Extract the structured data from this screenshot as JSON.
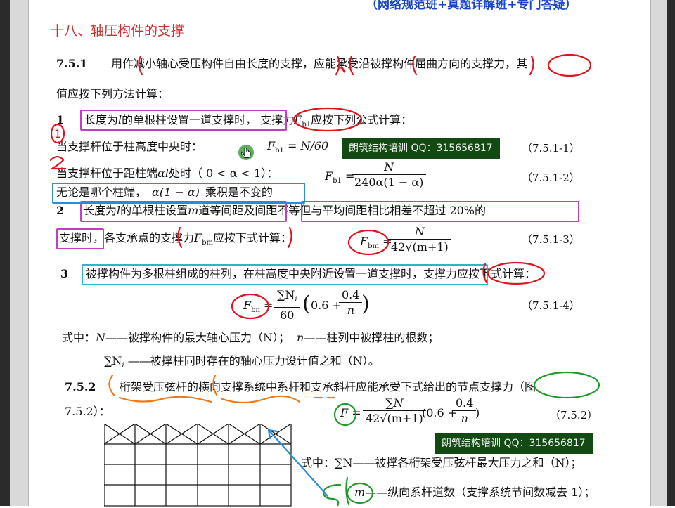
{
  "header": {
    "banner": "（网络规范班+真题详解班+专门答疑）"
  },
  "section": {
    "title": "十八、轴压构件的支撑"
  },
  "clause_751": {
    "number": "7.5.1",
    "line1_a": "用作",
    "line1_b": "减小轴心受压构件自由长度的支撑",
    "line1_c": "，",
    "line1_d": "应能承受",
    "line1_e": "沿被撑构件屈曲方向",
    "line1_f": "的",
    "line1_g": "支撑力",
    "line1_h": "，其",
    "line2": "值应按下列方法计算："
  },
  "item1": {
    "num": "1",
    "a": "长度为",
    "l": "l",
    "b": "的单根柱设置一道支撑时",
    "c": "，",
    "d": "支撑力",
    "F": "F",
    "sub": "b1",
    "e": "应按下列公式计算：",
    "case1": "当支撑杆位于柱高度中央时：",
    "eq1_lhs": "F",
    "eq1_sub": "b1",
    "eq1_rhs": "= N/60",
    "eq1_no": "（7.5.1-1）",
    "case2": "当支撑杆位于距柱端",
    "case2_al": "αl",
    "case2_b": "处时（ 0 < α < 1）：",
    "eq2_lhs": "F",
    "eq2_sub": "b1",
    "eq2_eq": "=",
    "eq2_num": "N",
    "eq2_den": "240α(1 − α)",
    "eq2_no": "（7.5.1-2）",
    "note": "无论是哪个柱端，",
    "note_expr": "α(1 − α)",
    "note_b": "乘积是不变的"
  },
  "item2": {
    "num": "2",
    "a": "长度为",
    "l": "l",
    "b": "的单根柱设置",
    "m": "m",
    "c": "道等间距",
    "d": "及",
    "e": "间距不等但与平均间距相比相差不超过 20%的",
    "f": "支撑时",
    "g": "，各支承点的支撑力",
    "F": "F",
    "sub": "bm",
    "h": "应按下式计算：",
    "eq_lhs": "F",
    "eq_sub": "bm",
    "eq_eq": "=",
    "eq_num": "N",
    "eq_den": "42√(m+1)",
    "eq_no": "（7.5.1-3）"
  },
  "item3": {
    "num": "3",
    "a": "被撑构件为多根柱组成的柱列，在柱高度中央附近设置一道支撑时",
    "b": "，",
    "c": "支撑力",
    "d": "应按下式计算：",
    "eq_lhs": "F",
    "eq_sub": "bn",
    "eq_eq": "=",
    "eq_num": "∑N",
    "eq_num_sub": "i",
    "eq_den": "60",
    "eq_open": "(",
    "eq_mid": "0.6 +",
    "eq_f2_num": "0.4",
    "eq_f2_den": "n",
    "eq_close": ")",
    "eq_no": "（7.5.1-4）",
    "where1_a": "式中：",
    "where1_N": "N",
    "where1_b": "——被撑构件的最大轴心压力（N）；",
    "where1_n": "n",
    "where1_c": "——柱列中被撑柱的根数；",
    "where2_sum": "∑N",
    "where2_sub": "i",
    "where2_b": "——被撑柱同时存在的轴心压力设计值之和（N）。"
  },
  "clause_752": {
    "number": "7.5.2",
    "a": "桁架受压弦杆的横向支撑系统中系杆和支承斜杆应能承受下式给出的节点支撑力（图",
    "b": "7.5.2）：",
    "eq_lhs": "F",
    "eq_eq": "=",
    "eq_num": "∑N",
    "eq_den": "42√(m+1)",
    "eq_mid": "(0.6 +",
    "eq_f2_num": "0.4",
    "eq_f2_den": "n",
    "eq_close": ")",
    "eq_no": "（7.5.2）",
    "where1_a": "式中：",
    "where1_sum": "∑N",
    "where1_b": "——被撑各桁架受压弦杆最大压力之和（N）；",
    "where2_m": "m",
    "where2_b": "——纵向系杆道数（支撑系统节间数减去 1）；"
  },
  "watermarks": [
    {
      "text": "朗筑结构培训   QQ：315656817"
    },
    {
      "text": "朗筑结构培训   QQ：315656817"
    }
  ],
  "annotations": {
    "mark1": "1",
    "mark2": "2"
  },
  "colors": {
    "title": "#c8322f",
    "banner": "#1a45c9",
    "pen_red": "#e0141e",
    "pen_pink": "#c43bc4",
    "pen_blue": "#2b8bd6",
    "pen_cyan": "#27b7c9",
    "pen_orange": "#f07818",
    "pen_green": "#1e9b2a",
    "watermark_bg": "#134a13"
  }
}
